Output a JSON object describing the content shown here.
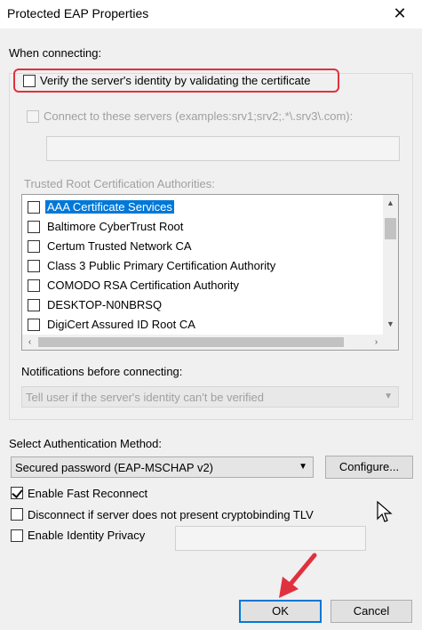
{
  "window": {
    "title": "Protected EAP Properties",
    "close_glyph": "✕"
  },
  "when_connecting": {
    "label": "When connecting:",
    "verify_label": "Verify the server's identity by validating the certificate",
    "verify_checked": false,
    "connect_servers_label": "Connect to these servers (examples:srv1;srv2;.*\\.srv3\\.com):",
    "connect_servers_checked": false,
    "connect_servers_value": "",
    "trusted_label": "Trusted Root Certification Authorities:",
    "certificates": [
      {
        "label": "AAA Certificate Services",
        "checked": false,
        "selected": true
      },
      {
        "label": "Baltimore CyberTrust Root",
        "checked": false,
        "selected": false
      },
      {
        "label": "Certum Trusted Network CA",
        "checked": false,
        "selected": false
      },
      {
        "label": "Class 3 Public Primary Certification Authority",
        "checked": false,
        "selected": false
      },
      {
        "label": "COMODO RSA Certification Authority",
        "checked": false,
        "selected": false
      },
      {
        "label": "DESKTOP-N0NBRSQ",
        "checked": false,
        "selected": false
      },
      {
        "label": "DigiCert Assured ID Root CA",
        "checked": false,
        "selected": false
      }
    ],
    "notifications_label": "Notifications before connecting:",
    "notifications_value": "Tell user if the server's identity can't be verified"
  },
  "auth": {
    "label": "Select Authentication Method:",
    "method_value": "Secured password (EAP-MSCHAP v2)",
    "configure_label": "Configure..."
  },
  "options": {
    "fast_reconnect_label": "Enable Fast Reconnect",
    "fast_reconnect_checked": true,
    "cryptobinding_label": "Disconnect if server does not present cryptobinding TLV",
    "cryptobinding_checked": false,
    "identity_privacy_label": "Enable Identity Privacy",
    "identity_privacy_checked": false,
    "identity_privacy_value": ""
  },
  "buttons": {
    "ok_label": "OK",
    "cancel_label": "Cancel"
  },
  "colors": {
    "highlight_red": "#e0313e",
    "selection_blue": "#0078d7"
  }
}
